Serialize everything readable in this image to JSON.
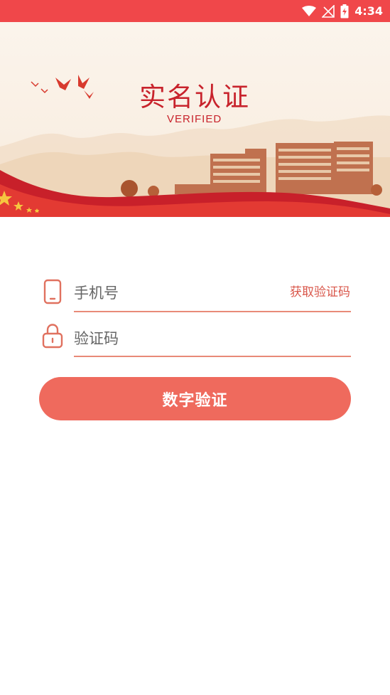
{
  "status_bar": {
    "time": "4:34"
  },
  "banner": {
    "title": "实名认证",
    "subtitle": "VERIFIED"
  },
  "form": {
    "phone_placeholder": "手机号",
    "get_code_label": "获取验证码",
    "code_placeholder": "验证码",
    "submit_label": "数字验证"
  },
  "colors": {
    "status_bar": "#f0474a",
    "accent": "#ef6a5d",
    "title_red": "#c8232c"
  },
  "icons": {
    "phone": "phone-icon",
    "lock": "lock-icon",
    "wifi": "wifi-icon",
    "signal": "no-signal-icon",
    "battery": "battery-charging-icon"
  }
}
